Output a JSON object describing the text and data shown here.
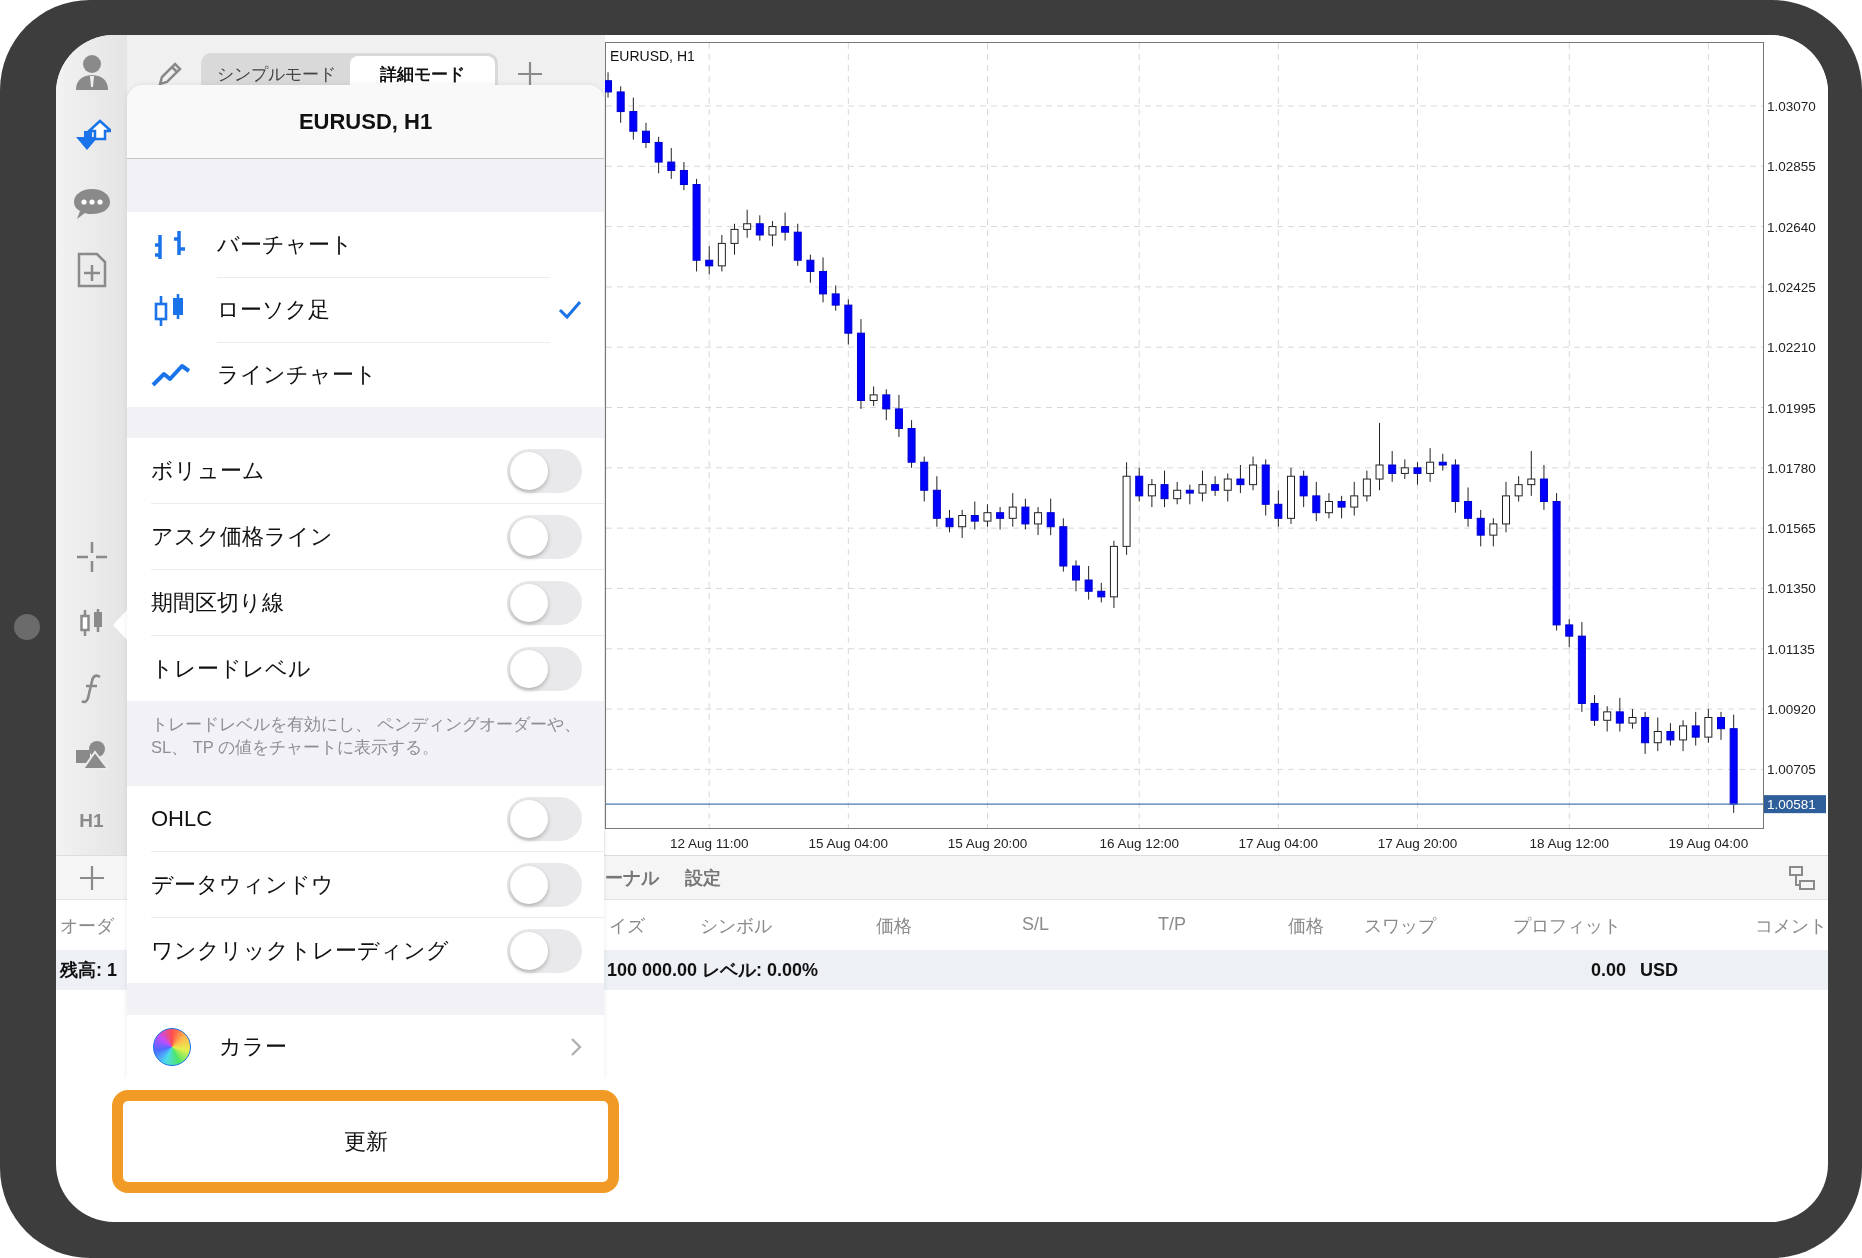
{
  "sidebar": {
    "timeframe_label": "H1"
  },
  "mode_tabs": [
    {
      "label": "シンプルモード",
      "selected": false
    },
    {
      "label": "詳細モード",
      "selected": true
    }
  ],
  "chart": {
    "symbol_label": "EURUSD, H1",
    "chart_data": {
      "type": "candlestick",
      "ylim": [
        1.00496,
        1.03298
      ],
      "grid": true,
      "ref_lines": [
        {
          "axis": "y",
          "value": 1.00581,
          "label": "1.00581",
          "color": "#4a78b0"
        }
      ],
      "categories": [
        null,
        null,
        null,
        null,
        null,
        null,
        null,
        null,
        "12 Aug 11:00",
        null,
        null,
        null,
        null,
        null,
        null,
        null,
        null,
        null,
        null,
        "15 Aug 04:00",
        null,
        null,
        null,
        null,
        null,
        null,
        null,
        null,
        null,
        null,
        "15 Aug 20:00",
        null,
        null,
        null,
        null,
        null,
        null,
        null,
        null,
        null,
        null,
        null,
        "16 Aug 12:00",
        null,
        null,
        null,
        null,
        null,
        null,
        null,
        null,
        null,
        null,
        "17 Aug 04:00",
        null,
        null,
        null,
        null,
        null,
        null,
        null,
        null,
        null,
        null,
        "17 Aug 20:00",
        null,
        null,
        null,
        null,
        null,
        null,
        null,
        null,
        null,
        null,
        null,
        "18 Aug 12:00",
        null,
        null,
        null,
        null,
        null,
        null,
        null,
        null,
        null,
        null,
        "19 Aug 04:00",
        null,
        null
      ],
      "ohlc": [
        [
          1.0316,
          1.0319,
          1.031,
          1.0312
        ],
        [
          1.0312,
          1.0314,
          1.0301,
          1.0305
        ],
        [
          1.0305,
          1.031,
          1.0295,
          1.0298
        ],
        [
          1.0298,
          1.0301,
          1.0292,
          1.0294
        ],
        [
          1.0294,
          1.0296,
          1.0283,
          1.0287
        ],
        [
          1.0287,
          1.0292,
          1.0281,
          1.0284
        ],
        [
          1.0284,
          1.0287,
          1.0277,
          1.0279
        ],
        [
          1.0279,
          1.0281,
          1.0248,
          1.0252
        ],
        [
          1.0252,
          1.0257,
          1.0247,
          1.025
        ],
        [
          1.025,
          1.0261,
          1.0248,
          1.0258
        ],
        [
          1.0258,
          1.0265,
          1.0254,
          1.0263
        ],
        [
          1.0263,
          1.027,
          1.026,
          1.0265
        ],
        [
          1.0265,
          1.0268,
          1.0259,
          1.0261
        ],
        [
          1.0261,
          1.0266,
          1.0257,
          1.0264
        ],
        [
          1.0264,
          1.0269,
          1.0259,
          1.0262
        ],
        [
          1.0262,
          1.0265,
          1.025,
          1.0252
        ],
        [
          1.0252,
          1.0254,
          1.0244,
          1.0248
        ],
        [
          1.0248,
          1.0253,
          1.0237,
          1.024
        ],
        [
          1.024,
          1.0243,
          1.0234,
          1.0236
        ],
        [
          1.0236,
          1.0238,
          1.0222,
          1.0226
        ],
        [
          1.0226,
          1.0231,
          1.0199,
          1.0202
        ],
        [
          1.0202,
          1.0207,
          1.02,
          1.0204
        ],
        [
          1.0204,
          1.0206,
          1.0195,
          1.0199
        ],
        [
          1.0199,
          1.0204,
          1.0189,
          1.0192
        ],
        [
          1.0192,
          1.0195,
          1.0178,
          1.018
        ],
        [
          1.018,
          1.0182,
          1.0166,
          1.017
        ],
        [
          1.017,
          1.0175,
          1.0157,
          1.016
        ],
        [
          1.016,
          1.0163,
          1.0155,
          1.0157
        ],
        [
          1.0157,
          1.0163,
          1.0153,
          1.0161
        ],
        [
          1.0161,
          1.0166,
          1.0156,
          1.0159
        ],
        [
          1.0159,
          1.0165,
          1.0157,
          1.0162
        ],
        [
          1.0162,
          1.0164,
          1.0156,
          1.016
        ],
        [
          1.016,
          1.0169,
          1.0157,
          1.0164
        ],
        [
          1.0164,
          1.0167,
          1.0156,
          1.0158
        ],
        [
          1.0158,
          1.0164,
          1.0154,
          1.0162
        ],
        [
          1.0162,
          1.0167,
          1.0154,
          1.0157
        ],
        [
          1.0157,
          1.016,
          1.0141,
          1.0143
        ],
        [
          1.0143,
          1.0145,
          1.0134,
          1.0138
        ],
        [
          1.0138,
          1.0143,
          1.0131,
          1.0134
        ],
        [
          1.0134,
          1.0137,
          1.013,
          1.0132
        ],
        [
          1.0132,
          1.0152,
          1.0128,
          1.015
        ],
        [
          1.015,
          1.018,
          1.0147,
          1.0175
        ],
        [
          1.0175,
          1.0178,
          1.0166,
          1.0168
        ],
        [
          1.0168,
          1.0174,
          1.0164,
          1.0172
        ],
        [
          1.0172,
          1.0177,
          1.0164,
          1.0167
        ],
        [
          1.0167,
          1.0173,
          1.0165,
          1.017
        ],
        [
          1.017,
          1.0172,
          1.0165,
          1.0169
        ],
        [
          1.0169,
          1.0177,
          1.0166,
          1.0172
        ],
        [
          1.0172,
          1.0175,
          1.0168,
          1.017
        ],
        [
          1.017,
          1.0176,
          1.0166,
          1.0174
        ],
        [
          1.0174,
          1.0179,
          1.0169,
          1.0172
        ],
        [
          1.0172,
          1.0182,
          1.017,
          1.0179
        ],
        [
          1.0179,
          1.0181,
          1.0161,
          1.0165
        ],
        [
          1.0165,
          1.017,
          1.0157,
          1.016
        ],
        [
          1.016,
          1.0178,
          1.0158,
          1.0175
        ],
        [
          1.0175,
          1.0177,
          1.0164,
          1.0168
        ],
        [
          1.0168,
          1.0173,
          1.0159,
          1.0162
        ],
        [
          1.0162,
          1.0169,
          1.016,
          1.0166
        ],
        [
          1.0166,
          1.0168,
          1.016,
          1.0164
        ],
        [
          1.0164,
          1.0173,
          1.0161,
          1.0168
        ],
        [
          1.0168,
          1.0177,
          1.0166,
          1.0174
        ],
        [
          1.0174,
          1.0194,
          1.017,
          1.0179
        ],
        [
          1.0179,
          1.0184,
          1.0173,
          1.0176
        ],
        [
          1.0176,
          1.0181,
          1.0174,
          1.0178
        ],
        [
          1.0178,
          1.018,
          1.0172,
          1.0176
        ],
        [
          1.0176,
          1.0185,
          1.0173,
          1.018
        ],
        [
          1.018,
          1.0183,
          1.0177,
          1.0179
        ],
        [
          1.0179,
          1.0181,
          1.0162,
          1.0166
        ],
        [
          1.0166,
          1.0171,
          1.0157,
          1.016
        ],
        [
          1.016,
          1.0163,
          1.015,
          1.0154
        ],
        [
          1.0154,
          1.016,
          1.015,
          1.0158
        ],
        [
          1.0158,
          1.0173,
          1.0155,
          1.0168
        ],
        [
          1.0168,
          1.0175,
          1.0166,
          1.0172
        ],
        [
          1.0172,
          1.0184,
          1.0168,
          1.0174
        ],
        [
          1.0174,
          1.0179,
          1.0163,
          1.0166
        ],
        [
          1.0166,
          1.0169,
          1.012,
          1.0122
        ],
        [
          1.0122,
          1.0124,
          1.0114,
          1.0118
        ],
        [
          1.0118,
          1.0123,
          1.0091,
          1.0094
        ],
        [
          1.0094,
          1.0097,
          1.0086,
          1.0088
        ],
        [
          1.0088,
          1.0093,
          1.0084,
          1.0091
        ],
        [
          1.0091,
          1.0096,
          1.0084,
          1.0087
        ],
        [
          1.0087,
          1.0092,
          1.0085,
          1.0089
        ],
        [
          1.0089,
          1.0091,
          1.0076,
          1.008
        ],
        [
          1.008,
          1.0089,
          1.0077,
          1.0084
        ],
        [
          1.0084,
          1.0087,
          1.0079,
          1.0081
        ],
        [
          1.0081,
          1.0088,
          1.0077,
          1.0086
        ],
        [
          1.0086,
          1.0091,
          1.0079,
          1.0082
        ],
        [
          1.0082,
          1.0092,
          1.008,
          1.0089
        ],
        [
          1.0089,
          1.0091,
          1.0081,
          1.0085
        ],
        [
          1.0085,
          1.009,
          1.0055,
          1.00581
        ]
      ],
      "yticks": [
        {
          "value": 1.0307,
          "label": "1.03070"
        },
        {
          "value": 1.02855,
          "label": "1.02855"
        },
        {
          "value": 1.0264,
          "label": "1.02640"
        },
        {
          "value": 1.02425,
          "label": "1.02425"
        },
        {
          "value": 1.0221,
          "label": "1.02210"
        },
        {
          "value": 1.01995,
          "label": "1.01995"
        },
        {
          "value": 1.0178,
          "label": "1.01780"
        },
        {
          "value": 1.01565,
          "label": "1.01565"
        },
        {
          "value": 1.0135,
          "label": "1.01350"
        },
        {
          "value": 1.01135,
          "label": "1.01135"
        },
        {
          "value": 1.0092,
          "label": "1.00920"
        },
        {
          "value": 1.00705,
          "label": "1.00705"
        }
      ]
    }
  },
  "popover": {
    "title": "EURUSD, H1",
    "chart_types": [
      {
        "kind": "bar",
        "label": "バーチャート",
        "selected": false
      },
      {
        "kind": "candle",
        "label": "ローソク足",
        "selected": true
      },
      {
        "kind": "line",
        "label": "ラインチャート",
        "selected": false
      }
    ],
    "toggles": [
      {
        "label": "ボリューム",
        "on": false
      },
      {
        "label": "アスク価格ライン",
        "on": false
      },
      {
        "label": "期間区切り線",
        "on": false
      },
      {
        "label": "トレードレベル",
        "on": false
      }
    ],
    "note": "トレードレベルを有効にし、 ペンディングオーダーや、 SL、 TP の値をチャートに表示する。",
    "toggles_2": [
      {
        "label": "OHLC",
        "on": false
      },
      {
        "label": "データウィンドウ",
        "on": false
      },
      {
        "label": "ワンクリックトレーディング",
        "on": false
      }
    ],
    "color_row": {
      "label": "カラー"
    },
    "update_button": "更新"
  },
  "terminal": {
    "tabs": [
      "ーナル",
      "設定"
    ],
    "columns": [
      "オーダ",
      "イズ",
      "シンボル",
      "価格",
      "S/L",
      "T/P",
      "価格",
      "スワップ",
      "プロフィット",
      "コメント"
    ],
    "balance_left": "残高: 1",
    "balance_text": "100 000.00 レベル: 0.00%",
    "profit": "0.00",
    "currency": "USD"
  }
}
